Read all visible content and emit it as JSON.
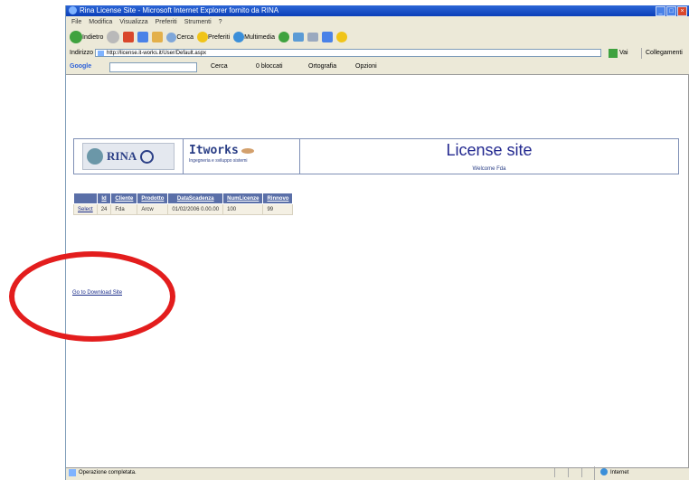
{
  "browser": {
    "title": "Rina License Site - Microsoft Internet Explorer fornito da RINA",
    "menu": [
      "File",
      "Modifica",
      "Visualizza",
      "Preferiti",
      "Strumenti",
      "?"
    ],
    "toolbar": {
      "back": "Indietro",
      "search": "Cerca",
      "favorites": "Preferiti",
      "media": "Multimedia"
    },
    "address_label": "Indirizzo",
    "address_url": "http://license.it-works.it/User/Default.aspx",
    "go_label": "Vai",
    "links_label": "Collegamenti",
    "google": {
      "brand": "Google",
      "search_btn": "Cerca",
      "blocked": "0 bloccati",
      "spelling": "Ortografia",
      "options": "Opzioni"
    },
    "status_text": "Operazione completata.",
    "zone_text": "Internet"
  },
  "page": {
    "logo_rina": "RINA",
    "logo_itworks": "Itworks",
    "itworks_sub": "Ingegneria e sviluppo sistemi",
    "site_title": "License site",
    "welcome": "Welcome Fda",
    "download_link": "Go to Download Site"
  },
  "table": {
    "headers": [
      "Id",
      "Cliente",
      "Prodotto",
      "DataScadenza",
      "NumLicenze",
      "Rinnovo"
    ],
    "rows": [
      {
        "select": "Select",
        "cells": [
          "24",
          "Fda",
          "Arcw",
          "01/02/2006 0.00.00",
          "100",
          "99"
        ]
      }
    ]
  },
  "colors": {
    "accent": "#22288f",
    "header_bg": "#5a6fa8",
    "highlight": "#e31d1d"
  }
}
